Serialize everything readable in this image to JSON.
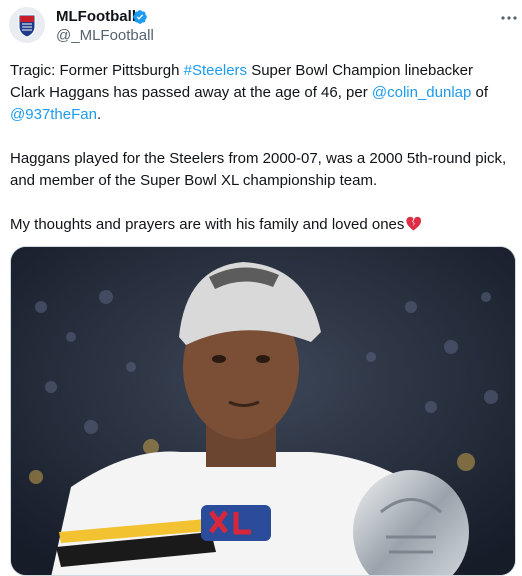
{
  "author": {
    "name": "MLFootball",
    "handle": "@_MLFootball",
    "verified": true,
    "avatar_icon": "mlfl-shield-logo"
  },
  "tweet": {
    "p1": {
      "t1": "Tragic: Former Pittsburgh ",
      "hashtag": "#Steelers",
      "t2": " Super Bowl Champion linebacker Clark Haggans has passed away at the age of 46, per ",
      "mention1": "@colin_dunlap",
      "t3": " of ",
      "mention2": "@937theFan",
      "t4": "."
    },
    "p2": "Haggans played for the Steelers from 2000-07, was a 2000 5th-round pick, and member of the Super Bowl XL championship team.",
    "p3": "My thoughts and prayers are with his family and loved ones",
    "emoji": "broken-heart-icon"
  },
  "colors": {
    "link": "#1d9bf0",
    "text": "#0f1419",
    "secondary": "#536471",
    "verified": "#1d9bf0"
  },
  "media": {
    "description_icon": "player-photo"
  }
}
